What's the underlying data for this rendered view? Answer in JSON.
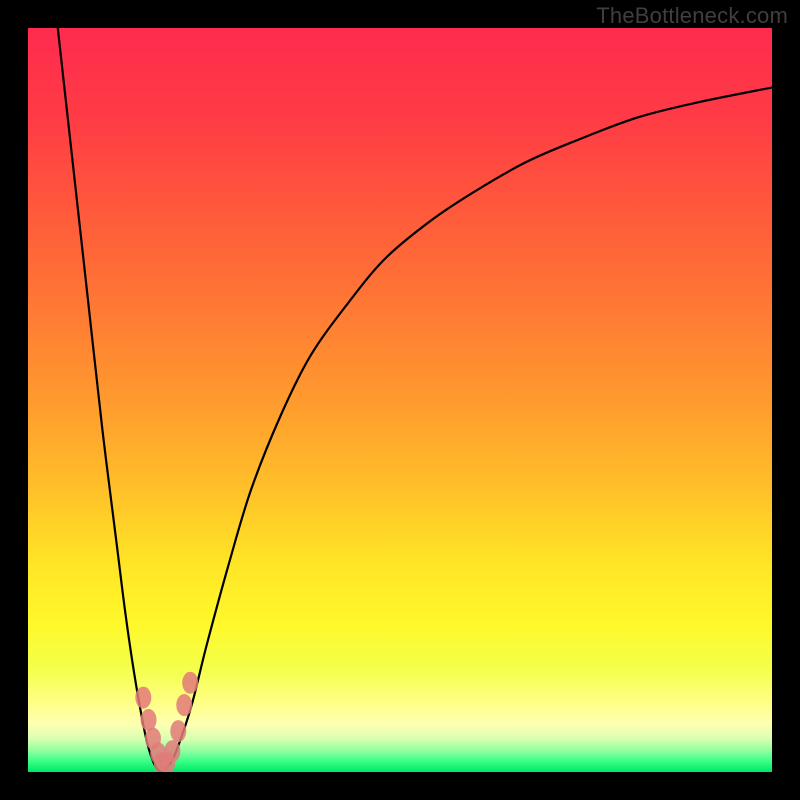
{
  "watermark": "TheBottleneck.com",
  "colors": {
    "frame": "#000000",
    "curve_stroke": "#000000",
    "marker_fill": "#e27a7a",
    "marker_stroke": "#e27a7a",
    "gradient_stops": [
      {
        "offset": 0.0,
        "color": "#ff2b4e"
      },
      {
        "offset": 0.12,
        "color": "#ff3b45"
      },
      {
        "offset": 0.25,
        "color": "#ff5a3b"
      },
      {
        "offset": 0.38,
        "color": "#ff7a34"
      },
      {
        "offset": 0.5,
        "color": "#ff9a2e"
      },
      {
        "offset": 0.62,
        "color": "#ffc029"
      },
      {
        "offset": 0.72,
        "color": "#ffe526"
      },
      {
        "offset": 0.8,
        "color": "#fff82a"
      },
      {
        "offset": 0.86,
        "color": "#f3ff4a"
      },
      {
        "offset": 0.905,
        "color": "#ffff82"
      },
      {
        "offset": 0.935,
        "color": "#ffffb3"
      },
      {
        "offset": 0.955,
        "color": "#d9ffb0"
      },
      {
        "offset": 0.972,
        "color": "#8effa0"
      },
      {
        "offset": 0.986,
        "color": "#36ff85"
      },
      {
        "offset": 1.0,
        "color": "#00e765"
      }
    ]
  },
  "chart_data": {
    "type": "line",
    "title": "",
    "xlabel": "",
    "ylabel": "",
    "xlim": [
      0,
      100
    ],
    "ylim": [
      0,
      100
    ],
    "grid": false,
    "series": [
      {
        "name": "bottleneck-curve",
        "x": [
          4,
          6,
          8,
          10,
          12,
          13,
          14,
          15,
          16,
          17,
          18,
          19,
          20,
          22,
          24,
          27,
          30,
          34,
          38,
          43,
          48,
          54,
          60,
          67,
          74,
          82,
          90,
          100
        ],
        "y": [
          100,
          82,
          64,
          46,
          30,
          22,
          15,
          9,
          4,
          1,
          0,
          1,
          3,
          9,
          17,
          28,
          38,
          48,
          56,
          63,
          69,
          74,
          78,
          82,
          85,
          88,
          90,
          92
        ]
      }
    ],
    "markers": [
      {
        "x": 15.5,
        "y": 10
      },
      {
        "x": 16.2,
        "y": 7
      },
      {
        "x": 16.8,
        "y": 4.5
      },
      {
        "x": 17.5,
        "y": 2.5
      },
      {
        "x": 18.0,
        "y": 1.2
      },
      {
        "x": 18.7,
        "y": 1.2
      },
      {
        "x": 19.4,
        "y": 2.8
      },
      {
        "x": 20.2,
        "y": 5.5
      },
      {
        "x": 21.0,
        "y": 9
      },
      {
        "x": 21.8,
        "y": 12
      }
    ]
  }
}
